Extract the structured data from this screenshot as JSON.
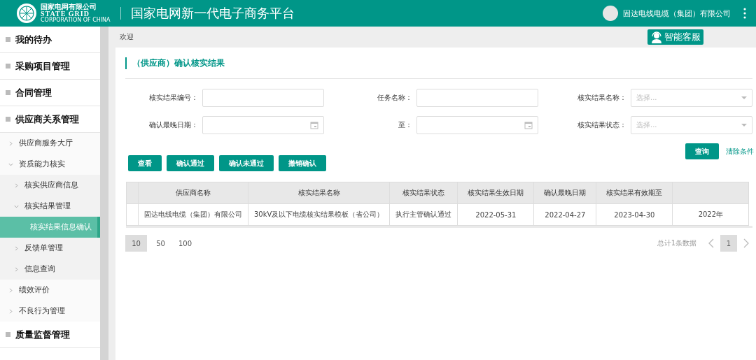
{
  "header": {
    "logo_cn": "国家电网有限公司",
    "logo_en": "STATE GRID",
    "logo_sub": "CORPORATION OF CHINA",
    "title": "国家电网新一代电子商务平台",
    "user": "固达电线电缆（集团）有限公司"
  },
  "sidebar": {
    "items": [
      {
        "label": "我的待办",
        "selected": false
      },
      {
        "label": "采购项目管理",
        "selected": false
      },
      {
        "label": "合同管理",
        "selected": false
      },
      {
        "label": "供应商关系管理",
        "selected": false,
        "children": [
          {
            "label": "供应商服务大厅",
            "expanded": false,
            "selected": false
          },
          {
            "label": "资质能力核实",
            "expanded": true,
            "selected": false,
            "children": [
              {
                "label": "核实供应商信息",
                "expanded": false,
                "selected": false
              },
              {
                "label": "核实结果管理",
                "expanded": true,
                "selected": false,
                "children": [
                  {
                    "label": "核实结果信息确认",
                    "selected": true
                  }
                ]
              },
              {
                "label": "反馈单管理",
                "expanded": false,
                "selected": false
              },
              {
                "label": "信息查询",
                "expanded": false,
                "selected": false
              }
            ]
          },
          {
            "label": "绩效评价",
            "expanded": false,
            "selected": false
          },
          {
            "label": "不良行为管理",
            "expanded": false,
            "selected": false
          }
        ]
      },
      {
        "label": "质量监督管理",
        "selected": false
      }
    ]
  },
  "breadcrumb": "欢迎",
  "support_button": "智能客服",
  "panel_title": "（供应商）确认核实结果",
  "filters": [
    {
      "label": "核实结果编号：",
      "kind": "text"
    },
    {
      "label": "任务名称：",
      "kind": "text"
    },
    {
      "label": "核实结果名称：",
      "kind": "select",
      "placeholder": "选择..."
    },
    {
      "label": "确认最晚日期：",
      "kind": "date"
    },
    {
      "label": "至：",
      "kind": "date"
    },
    {
      "label": "核实结果状态：",
      "kind": "select",
      "placeholder": "选择..."
    }
  ],
  "query_button": "查询",
  "clear_link": "清除条件",
  "actions": [
    "查看",
    "确认通过",
    "确认未通过",
    "撤销确认"
  ],
  "table": {
    "columns": [
      "供应商名称",
      "核实结果名称",
      "核实结果状态",
      "核实结果生效日期",
      "确认最晚日期",
      "核实结果有效期至"
    ],
    "rows": [
      [
        "固达电线电缆（集团）有限公司",
        "30kV及以下电缆核实结果模板（省公司）",
        "执行主管确认通过",
        "2022-05-31",
        "2022-04-27",
        "2023-04-30",
        "2022年"
      ]
    ]
  },
  "pagination": {
    "page_sizes": [
      {
        "label": "10",
        "selected": true
      },
      {
        "label": "50",
        "selected": false
      },
      {
        "label": "100",
        "selected": false
      }
    ],
    "total": "总计1条数据",
    "pages": [
      {
        "label": "1",
        "selected": true
      }
    ]
  }
}
